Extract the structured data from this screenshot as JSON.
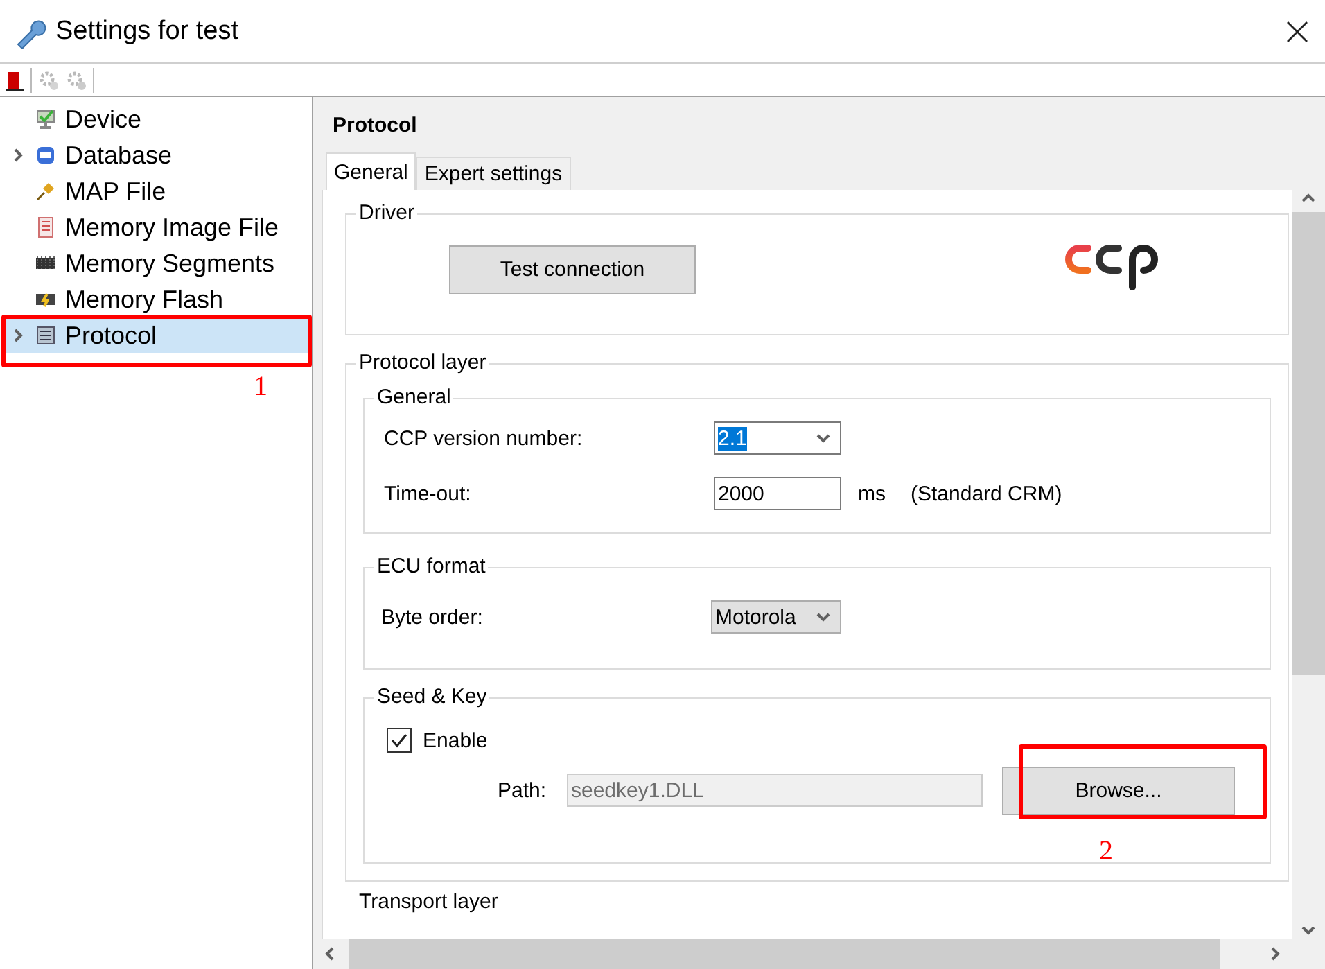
{
  "window": {
    "title": "Settings for test"
  },
  "tree": [
    {
      "label": "Device",
      "expandable": false,
      "selected": false
    },
    {
      "label": "Database",
      "expandable": true,
      "selected": false
    },
    {
      "label": "MAP File",
      "expandable": false,
      "selected": false
    },
    {
      "label": "Memory Image File",
      "expandable": false,
      "selected": false
    },
    {
      "label": "Memory Segments",
      "expandable": false,
      "selected": false
    },
    {
      "label": "Memory Flash",
      "expandable": false,
      "selected": false
    },
    {
      "label": "Protocol",
      "expandable": true,
      "selected": true
    }
  ],
  "panel": {
    "title": "Protocol",
    "tabs": [
      {
        "label": "General",
        "selected": true
      },
      {
        "label": "Expert settings",
        "selected": false
      }
    ],
    "driver": {
      "title": "Driver",
      "button": "Test connection"
    },
    "protocol_layer": {
      "title": "Protocol layer",
      "general": {
        "title": "General",
        "version_label": "CCP version number:",
        "version_value": "2.1",
        "timeout_label": "Time-out:",
        "timeout_value": "2000",
        "timeout_unit": "ms",
        "timeout_note": "(Standard CRM)"
      },
      "ecu_format": {
        "title": "ECU format",
        "byte_order_label": "Byte order:",
        "byte_order_value": "Motorola"
      },
      "seed_key": {
        "title": "Seed & Key",
        "enable_label": "Enable",
        "checked": true,
        "path_label": "Path:",
        "path_value": "seedkey1.DLL",
        "path_disabled": true,
        "browse": "Browse..."
      }
    },
    "transport_layer": {
      "title": "Transport layer"
    }
  },
  "annotations": [
    {
      "label": "1"
    },
    {
      "label": "2"
    }
  ]
}
